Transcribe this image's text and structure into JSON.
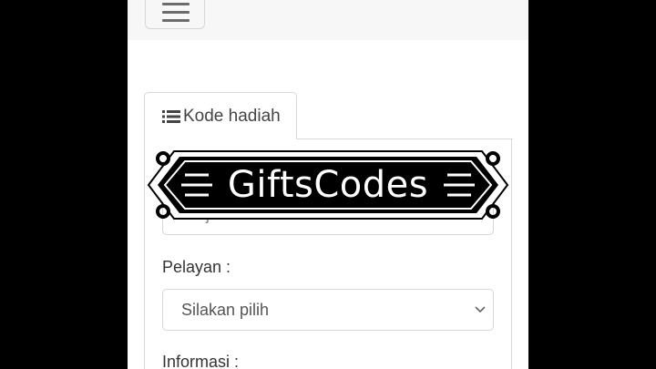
{
  "tabs": [
    {
      "label": "Kode hadiah",
      "icon": "list-icon"
    }
  ],
  "form": {
    "first_field_value": "Ninja Lhari Jalan",
    "service_label": "Pelayan :",
    "service_select_value": "Silakan pilih",
    "info_label": "Informasi :"
  },
  "overlay": {
    "title": "GiftsCodes"
  }
}
